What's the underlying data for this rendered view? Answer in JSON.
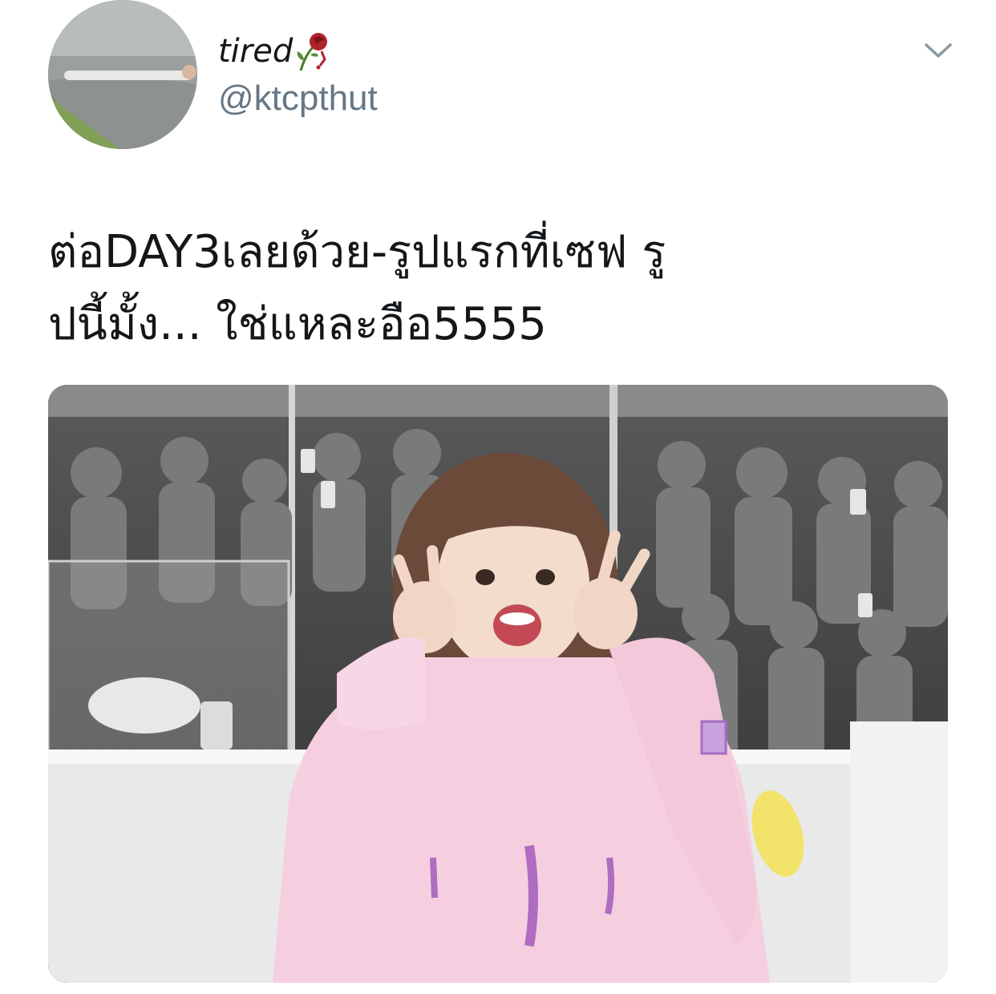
{
  "author": {
    "display_name": "tired",
    "handle": "@ktcpthut"
  },
  "tweet": {
    "lines": [
      "ต่อDAY3เลยด้วย-รูปแรกที่เซฟ รู",
      "ปนี้มั้ง... ใช่แหละอือ5555"
    ]
  },
  "icons": {
    "more": "chevron-down-icon",
    "name_emoji": "wilted-rose-icon"
  },
  "colors": {
    "text": "#14171a",
    "secondary": "#657786",
    "sweater": "#f5cfe0"
  }
}
